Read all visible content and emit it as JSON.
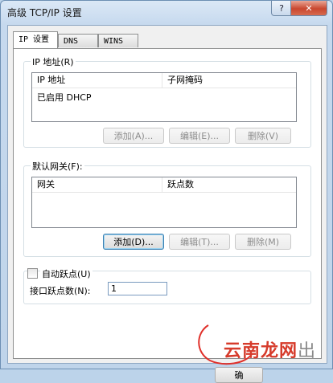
{
  "window": {
    "title": "高级 TCP/IP 设置",
    "help_label": "?",
    "close_label": "✕"
  },
  "tabs": [
    {
      "label": "IP 设置",
      "active": true
    },
    {
      "label": "DNS",
      "active": false
    },
    {
      "label": "WINS",
      "active": false
    }
  ],
  "ip_section": {
    "label": "IP 地址(R)",
    "columns": [
      "IP 地址",
      "子网掩码"
    ],
    "rows": [
      [
        "已启用 DHCP",
        ""
      ]
    ],
    "buttons": {
      "add": "添加(A)...",
      "edit": "编辑(E)...",
      "delete": "删除(V)"
    }
  },
  "gateway_section": {
    "label": "默认网关(F):",
    "columns": [
      "网关",
      "跃点数"
    ],
    "rows": [],
    "buttons": {
      "add": "添加(D)...",
      "edit": "编辑(T)...",
      "delete": "删除(M)"
    }
  },
  "metric": {
    "auto_label": "自动跃点(U)",
    "auto_checked": false,
    "interface_label": "接口跃点数(N):",
    "interface_value": "1"
  },
  "footer": {
    "ok_label": "确",
    "watermark": "云南龙网",
    "watermark_accent": "出"
  },
  "colors": {
    "accent_close": "#c9472f",
    "watermark": "#d63b2b"
  }
}
